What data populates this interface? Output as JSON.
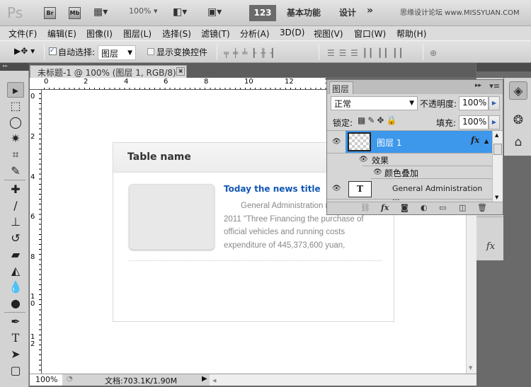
{
  "titlebar": {
    "logo": "Ps",
    "bridge": "Br",
    "minibridge": "Mb",
    "zoom": "100%",
    "badge": "123",
    "workspace_essentials": "基本功能",
    "workspace_design": "设计",
    "more": "»",
    "watermark": "思缘设计论坛 www.MISSYUAN.COM"
  },
  "menu": [
    "文件(F)",
    "编辑(E)",
    "图像(I)",
    "图层(L)",
    "选择(S)",
    "滤镜(T)",
    "分析(A)",
    "3D(D)",
    "视图(V)",
    "窗口(W)",
    "帮助(H)"
  ],
  "options": {
    "auto_select_label": "自动选择:",
    "auto_select_checked": true,
    "auto_select_value": "图层",
    "show_transform_label": "显示变换控件",
    "show_transform_checked": false
  },
  "document": {
    "tab_title": "未标题-1 @ 100% (图层 1, RGB/8) *",
    "close": "×"
  },
  "rulers": {
    "h": [
      "0",
      "2",
      "4",
      "6",
      "8",
      "10",
      "12",
      "1"
    ],
    "v": [
      "0",
      "2",
      "4",
      "6",
      "8",
      "10",
      "12"
    ]
  },
  "canvas": {
    "table_name": "Table name",
    "news_title": "Today the news title",
    "news_body": "General Administration released the 2011 \"Three Financing the purchase of official vehicles and running costs expenditure of 445,373,600 yuan,"
  },
  "status": {
    "zoom": "100%",
    "doc": "文档:703.1K/1.90M"
  },
  "layers_panel": {
    "tab": "图层",
    "blend_mode": "正常",
    "opacity_label": "不透明度:",
    "opacity": "100%",
    "lock_label": "锁定:",
    "fill_label": "填充:",
    "fill": "100%",
    "layers": [
      {
        "name": "图层 1",
        "selected": true,
        "fx": "fx"
      },
      {
        "name": "效果"
      },
      {
        "name": "颜色叠加"
      },
      {
        "name": "General Administration ...",
        "type_icon": "T"
      }
    ]
  },
  "colors": {
    "selection": "#3d97ea",
    "link": "#1258b5"
  }
}
